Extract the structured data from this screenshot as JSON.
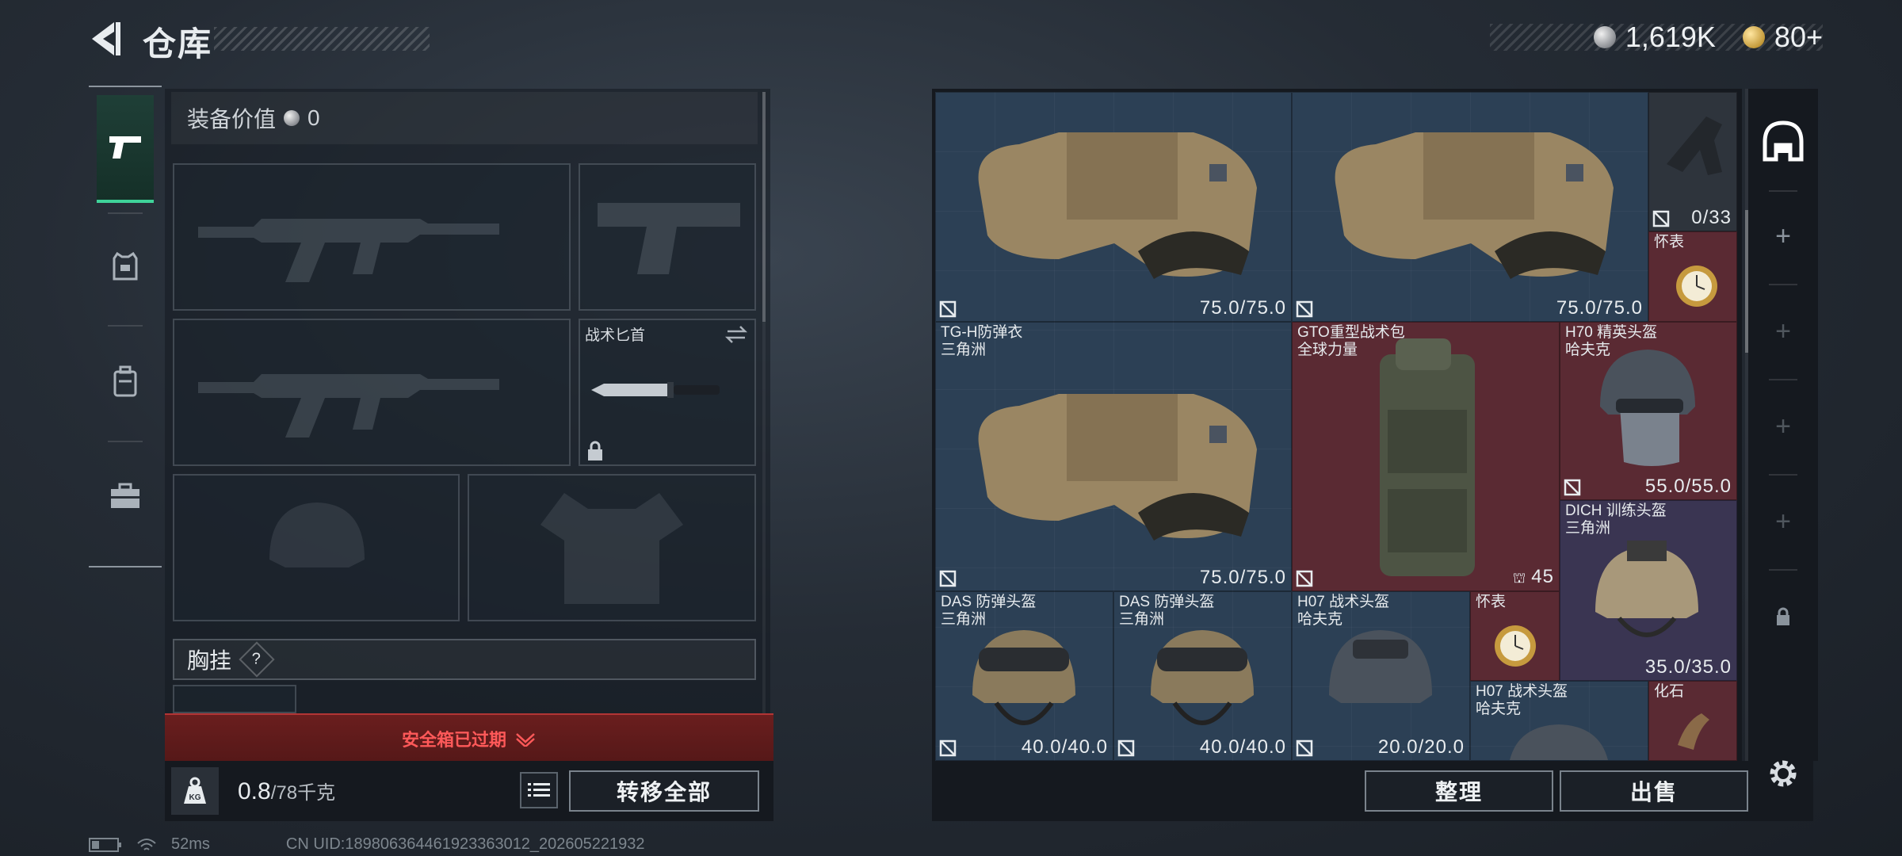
{
  "header": {
    "title": "仓库"
  },
  "currency": {
    "silver": "1,619K",
    "gold": "80+"
  },
  "equipment": {
    "value_label": "装备价值",
    "value": "0",
    "melee_slot_label": "战术匕首",
    "chest_label": "胸挂",
    "chest_help": "?"
  },
  "safe_box": {
    "expired_text": "安全箱已过期"
  },
  "capacity": {
    "current": "0.8",
    "max": "/78千克"
  },
  "buttons": {
    "transfer_all": "转移全部",
    "organize": "整理",
    "sell": "出售"
  },
  "storage_items": [
    {
      "name": "",
      "sub": "",
      "durability": "75.0/75.0"
    },
    {
      "name": "",
      "sub": "",
      "durability": "75.0/75.0"
    },
    {
      "name": "",
      "sub": "",
      "count": "0/33"
    },
    {
      "name": "怀表",
      "sub": ""
    },
    {
      "name": "TG-H防弹衣",
      "sub": "三角洲",
      "durability": "75.0/75.0"
    },
    {
      "name": "GTO重型战术包",
      "sub": "全球力量",
      "capacity": "45"
    },
    {
      "name": "H70 精英头盔",
      "sub": "哈夫克",
      "durability": "55.0/55.0"
    },
    {
      "name": "DICH 训练头盔",
      "sub": "三角洲",
      "durability": "35.0/35.0"
    },
    {
      "name": "DAS 防弹头盔",
      "sub": "三角洲",
      "durability": "40.0/40.0"
    },
    {
      "name": "DAS 防弹头盔",
      "sub": "三角洲",
      "durability": "40.0/40.0"
    },
    {
      "name": "H07 战术头盔",
      "sub": "哈夫克",
      "durability": "20.0/20.0"
    },
    {
      "name": "怀表",
      "sub": ""
    },
    {
      "name": "H07 战术头盔",
      "sub": "哈夫克"
    },
    {
      "name": "化石",
      "sub": ""
    }
  ],
  "status_bar": {
    "ping": "52ms",
    "uid": "CN UID:1898063644619233630​12_202605221932"
  },
  "colors": {
    "accent_green": "#3fd39a",
    "warning_red": "#ff5959",
    "slot_red": "#5a2a33",
    "slot_purple": "#3a3552",
    "grid_blue": "#2c3e51"
  },
  "icons": [
    "back-arrow-icon",
    "pistol-icon",
    "armor-icon",
    "backpack-icon",
    "toolbox-icon",
    "weight-icon",
    "list-icon",
    "safehouse-icon",
    "plus-icon",
    "lock-icon",
    "gear-icon",
    "no-insure-icon",
    "chevron-down-icon",
    "battery-icon",
    "wifi-icon"
  ]
}
